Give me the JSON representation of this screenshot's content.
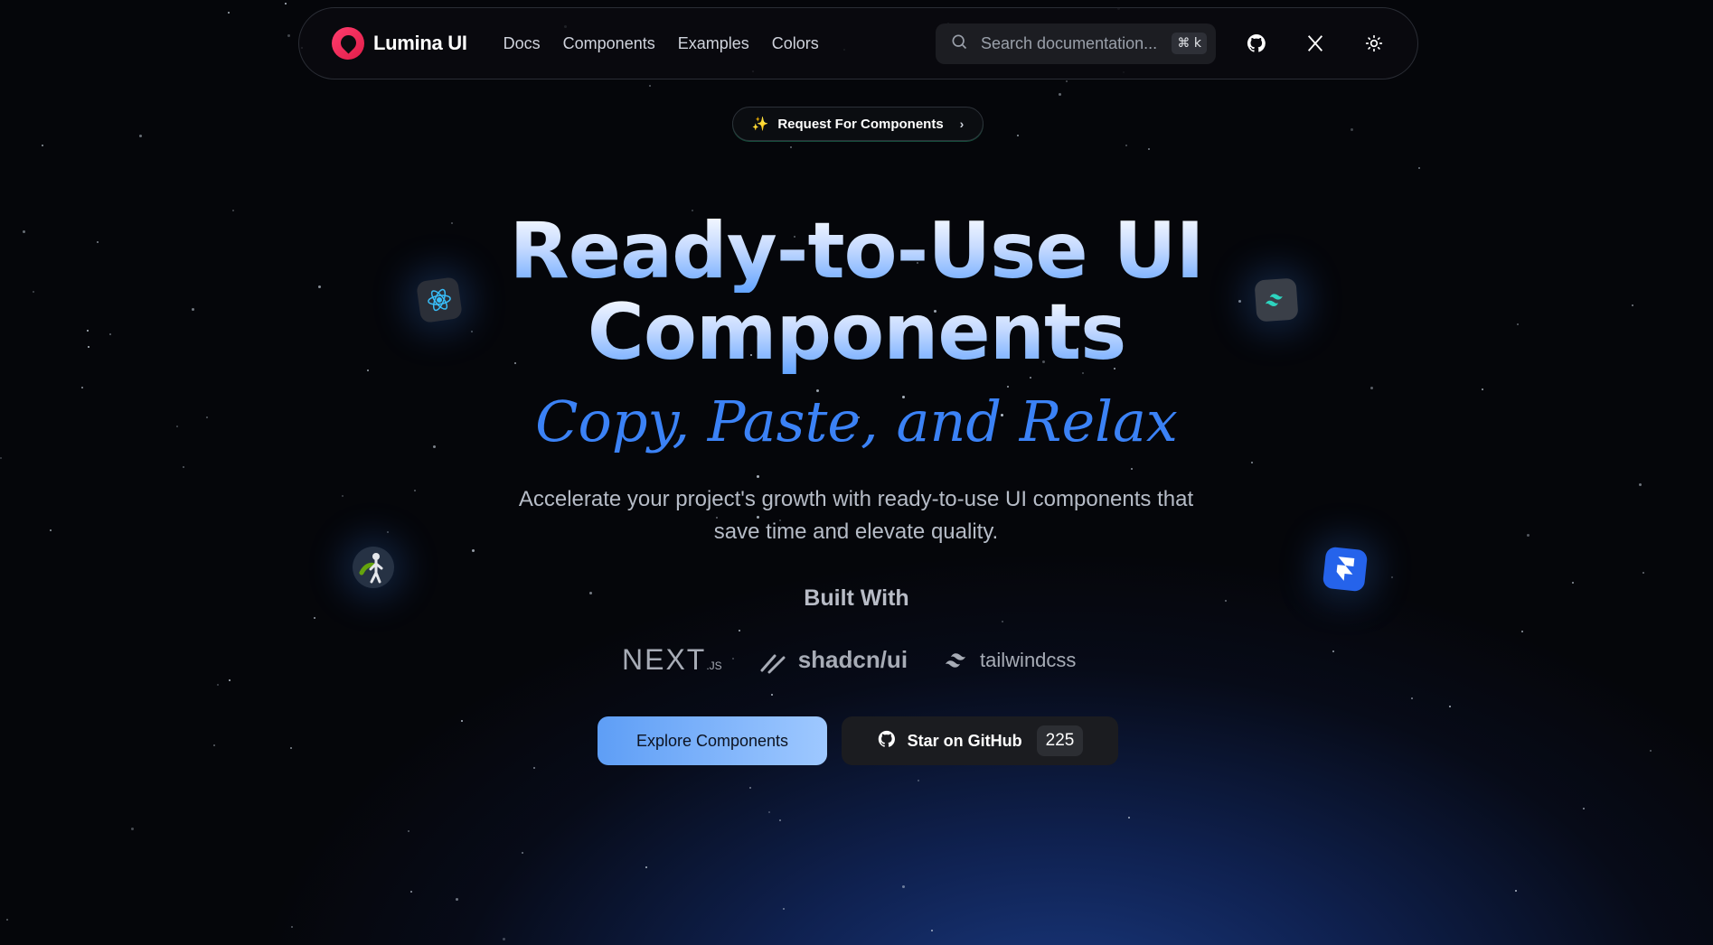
{
  "nav": {
    "brand": "Lumina UI",
    "links": [
      "Docs",
      "Components",
      "Examples",
      "Colors"
    ],
    "search_placeholder": "Search documentation...",
    "shortcut": "⌘ k",
    "icons": [
      "github-icon",
      "x-icon",
      "sun-icon"
    ]
  },
  "badge": {
    "emoji": "✨",
    "label": "Request For Components",
    "chevron": "›"
  },
  "hero": {
    "title_line1": "Ready-to-Use UI",
    "title_line2": "Components",
    "subtitle": "Copy, Paste, and Relax",
    "description": "Accelerate your project's growth with ready-to-use UI components that save time and elevate quality.",
    "built_with": "Built With",
    "logos": {
      "next": "NEXT",
      "next_suffix": ".JS",
      "shadcn": "shadcn/ui",
      "tailwind": "tailwindcss"
    }
  },
  "buttons": {
    "explore": "Explore Components",
    "star": "Star on GitHub",
    "star_count": "225"
  },
  "floating_icons": [
    "react-icon",
    "tailwind-icon",
    "node-icon",
    "framer-icon"
  ],
  "colors": {
    "accent": "#3b82f6",
    "brand": "#e11d48",
    "background": "#05060a"
  }
}
